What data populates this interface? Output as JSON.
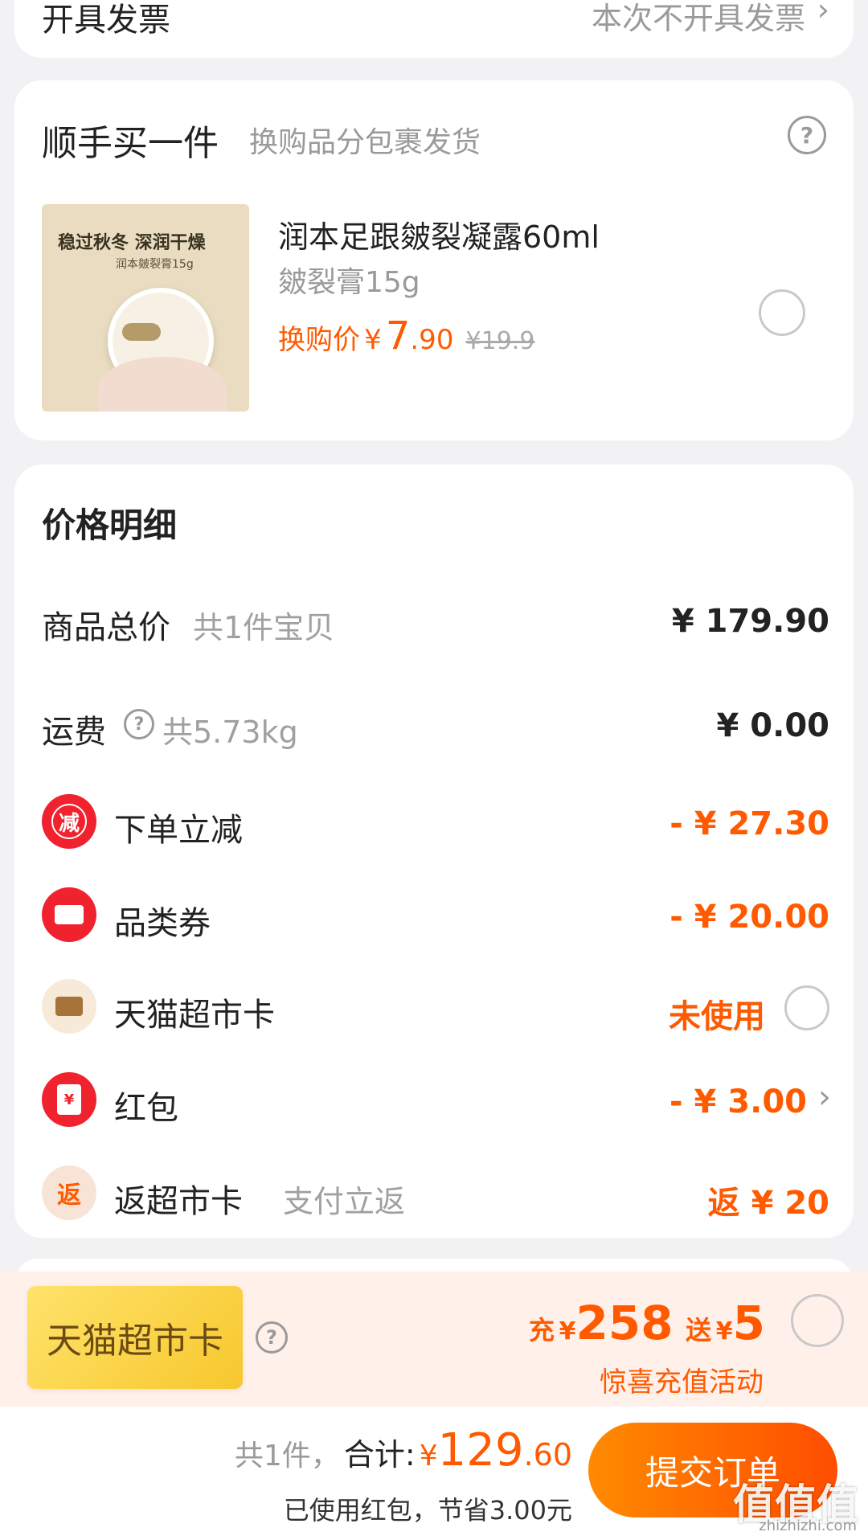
{
  "invoice": {
    "label": "开具发票",
    "value": "本次不开具发票"
  },
  "addon": {
    "title": "顺手买一件",
    "subtitle": "换购品分包裹发货",
    "product": {
      "image_text_1": "稳过秋冬 深润干燥",
      "image_text_2": "润本皴裂膏15g",
      "name": "润本足跟皴裂凝露60ml",
      "spec": "皴裂膏15g",
      "price_label": "换购价",
      "currency": "¥",
      "price_int": "7",
      "price_dec": ".90",
      "original_price": "¥19.9"
    }
  },
  "price_detail": {
    "title": "价格明细",
    "rows": [
      {
        "label": "商品总价",
        "sub": "共1件宝贝",
        "value": "¥ 179.90"
      },
      {
        "label": "运费",
        "sub": "共5.73kg",
        "value": "¥ 0.00"
      },
      {
        "label": "下单立减",
        "value": "- ¥ 27.30",
        "badge_text": "减"
      },
      {
        "label": "品类券",
        "value": "- ¥ 20.00"
      },
      {
        "label": "天猫超市卡",
        "value": "未使用"
      },
      {
        "label": "红包",
        "value": "- ¥ 3.00",
        "badge_text": "¥"
      },
      {
        "label": "返超市卡",
        "sub": "支付立返",
        "value": "返 ¥ 20",
        "badge_text": "返"
      }
    ]
  },
  "promo": {
    "card_label": "天猫超市卡",
    "charge_label": "充",
    "charge_amount": "258",
    "gift_label": "送",
    "gift_amount": "5",
    "currency": "¥",
    "activity": "惊喜充值活动"
  },
  "footer": {
    "count": "共1件，",
    "total_label": "合计:",
    "currency": "¥",
    "total_int": "129",
    "total_dec": ".60",
    "saving": "已使用红包，节省3.00元",
    "submit": "提交订单",
    "watermark": "值值值",
    "watermark_url": "zhizhizhi.com"
  },
  "colors": {
    "accent": "#ff5a00",
    "red": "#f0222e",
    "card_gold": "#ffd84a",
    "promo_bg": "#fff0ea"
  }
}
